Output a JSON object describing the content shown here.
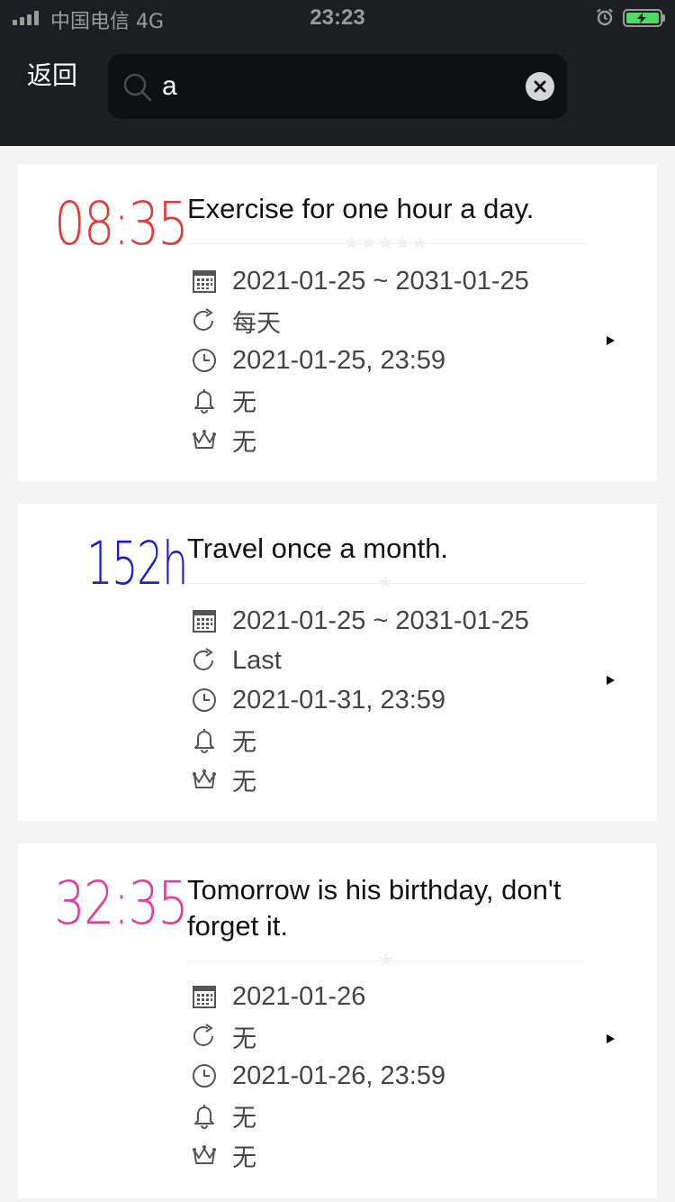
{
  "status_bar": {
    "carrier": "中国电信  4G",
    "time": "23:23"
  },
  "nav": {
    "back_label": "返回"
  },
  "search": {
    "value": "a",
    "placeholder": ""
  },
  "colors": {
    "header_bg": "#1c1e21",
    "battery_green": "#4cd964",
    "card1_accent": "#e53935",
    "card2_accent": "#1a1ad6",
    "card3_accent": "#e040a0"
  },
  "cards": [
    {
      "big_time": "08:35",
      "title": "Exercise for one hour a day.",
      "stars": "★★★★★",
      "date_range": "2021-01-25 ~ 2031-01-25",
      "repeat": "每天",
      "deadline": "2021-01-25, 23:59",
      "reminder": "无",
      "reward": "无"
    },
    {
      "big_time": "152h",
      "title": "Travel once a month.",
      "stars": "★",
      "date_range": "2021-01-25 ~ 2031-01-25",
      "repeat": "Last",
      "deadline": "2021-01-31, 23:59",
      "reminder": "无",
      "reward": "无"
    },
    {
      "big_time": "32:35",
      "title": "Tomorrow is his birthday, don't forget it.",
      "stars": "★",
      "date_range": "2021-01-26",
      "repeat": "无",
      "deadline": "2021-01-26, 23:59",
      "reminder": "无",
      "reward": "无"
    }
  ]
}
